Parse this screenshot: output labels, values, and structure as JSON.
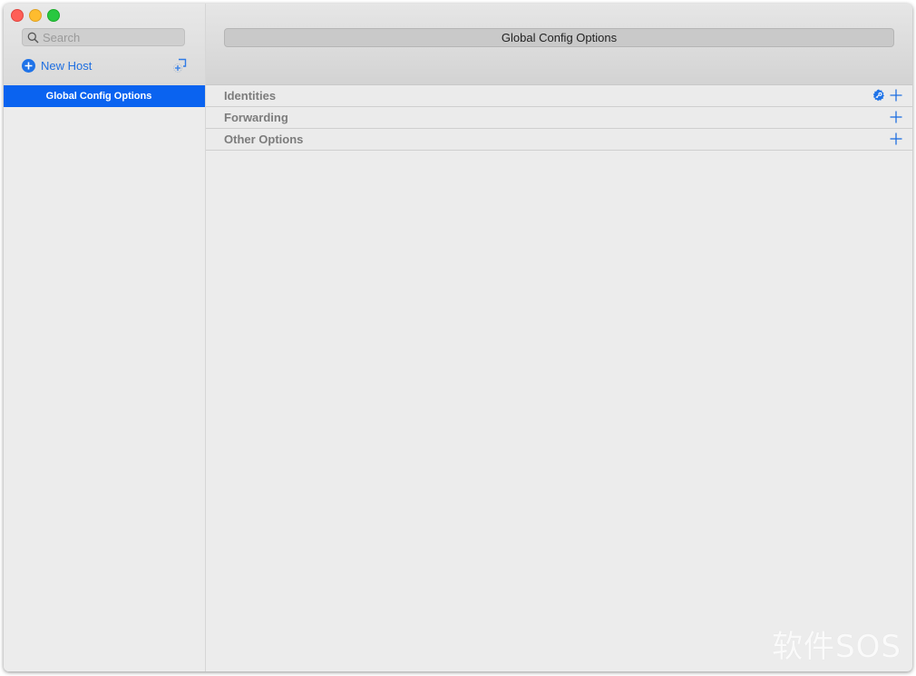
{
  "window": {
    "controls": [
      "close",
      "minimize",
      "maximize"
    ]
  },
  "sidebar": {
    "search": {
      "placeholder": "Search",
      "value": ""
    },
    "new_host_label": "New Host",
    "items": [
      {
        "label": "Global Config Options",
        "selected": true
      }
    ]
  },
  "main": {
    "title": "Global Config Options",
    "sections": [
      {
        "label": "Identities",
        "has_key_action": true
      },
      {
        "label": "Forwarding",
        "has_key_action": false
      },
      {
        "label": "Other Options",
        "has_key_action": false
      }
    ]
  },
  "watermark": "软件SOS",
  "colors": {
    "accent": "#0a63f0",
    "link": "#1f6fe0",
    "section_label": "#7c7c7c"
  }
}
